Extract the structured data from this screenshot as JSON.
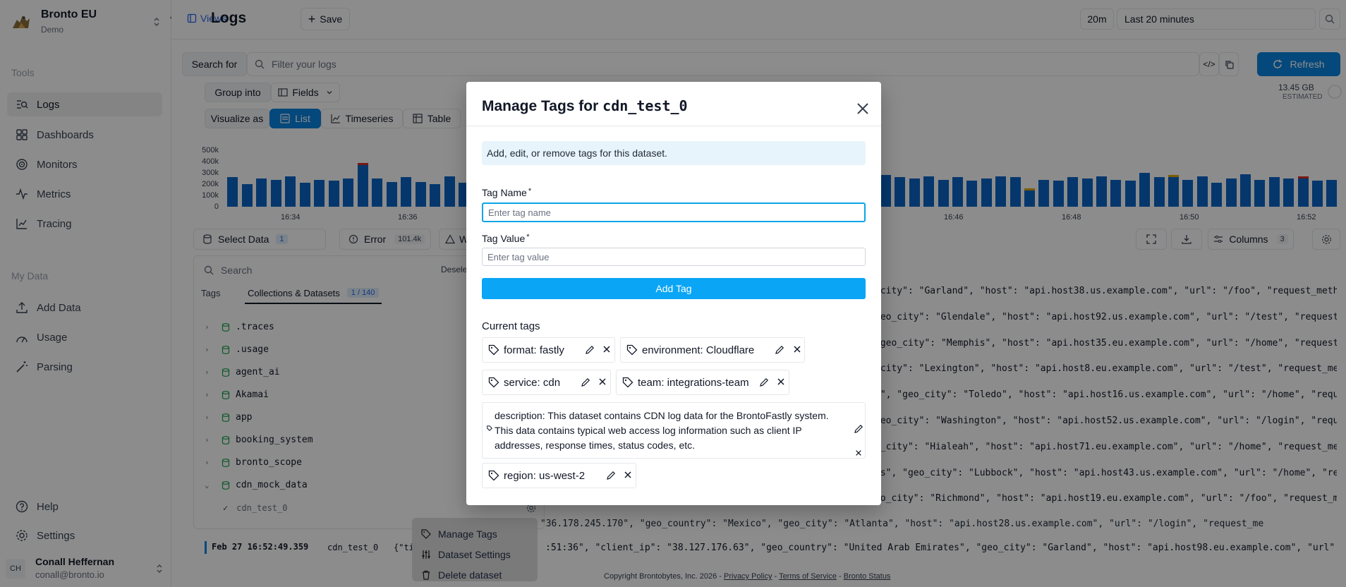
{
  "sidebar": {
    "org_name": "Bronto EU",
    "org_sub": "Demo",
    "tools_label": "Tools",
    "tools": [
      {
        "label": "Logs",
        "active": true
      },
      {
        "label": "Dashboards"
      },
      {
        "label": "Monitors"
      },
      {
        "label": "Metrics"
      },
      {
        "label": "Tracing"
      }
    ],
    "mydata_label": "My Data",
    "mydata": [
      {
        "label": "Add Data"
      },
      {
        "label": "Usage"
      },
      {
        "label": "Parsing"
      }
    ],
    "help": "Help",
    "settings": "Settings",
    "user_initials": "CH",
    "user_name": "Conall Heffernan",
    "user_email": "conall@bronto.io"
  },
  "topbar": {
    "views": "Views",
    "title": "Logs",
    "save": "Save",
    "time_short": "20m",
    "time_long": "Last 20 minutes"
  },
  "search": {
    "label": "Search for",
    "placeholder": "Filter your logs",
    "refresh": "Refresh",
    "size": "13.45 GB",
    "estimated": "ESTIMATED"
  },
  "controls": {
    "group_into": "Group into",
    "fields": "Fields",
    "visualize_as": "Visualize as",
    "list": "List",
    "timeseries": "Timeseries",
    "table": "Table"
  },
  "histogram": {
    "y_ticks": [
      "500k",
      "400k",
      "300k",
      "200k",
      "100k",
      "0"
    ],
    "x_ticks_left": [
      "16:34",
      "16:36"
    ],
    "x_ticks_right": [
      "16:46",
      "16:48",
      "16:50",
      "16:52"
    ],
    "values_left": [
      260,
      200,
      250,
      240,
      270,
      210,
      240,
      230,
      250,
      390,
      250,
      220,
      260,
      220,
      200,
      270,
      210,
      220,
      150,
      170
    ],
    "values_right": [
      280,
      260,
      250,
      270,
      240,
      260,
      230,
      250,
      270,
      260,
      160,
      240,
      230,
      260,
      250,
      270,
      240,
      230,
      300,
      260,
      280,
      240,
      270,
      210,
      250,
      290,
      240,
      260,
      250,
      270,
      230,
      240
    ],
    "red_left": [
      9
    ],
    "red_right": [
      29
    ],
    "yellow_right": [
      10,
      20
    ]
  },
  "filters": {
    "select_data": "Select Data",
    "select_count": "1",
    "error": "Error",
    "error_count": "101.4k",
    "warn_prefix": "W",
    "columns": "Columns",
    "columns_count": "3"
  },
  "datasets": {
    "search_placeholder": "Search",
    "deselect": "Deselec",
    "tab_tags": "Tags",
    "tab_collections": "Collections & Datasets",
    "tab_count": "1 / 140",
    "items": [
      ".traces",
      ".usage",
      "agent_ai",
      "Akamai",
      "app",
      "booking_system",
      "bronto_scope",
      "cdn_mock_data"
    ],
    "child": "cdn_test_0"
  },
  "logs": {
    "lines": [
      "_city\": \"Garland\", \"host\": \"api.host38.us.example.com\", \"url\": \"/foo\", \"request_method\"",
      "geo_city\": \"Glendale\", \"host\": \"api.host92.us.example.com\", \"url\": \"/test\", \"request_me",
      "\"geo_city\": \"Memphis\", \"host\": \"api.host35.eu.example.com\", \"url\": \"/home\", \"request_m",
      "_city\": \"Lexington\", \"host\": \"api.host8.eu.example.com\", \"url\": \"/test\", \"request_metho",
      "s\", \"geo_city\": \"Toledo\", \"host\": \"api.host16.us.example.com\", \"url\": \"/home\", \"request_",
      "geo_city\": \"Washington\", \"host\": \"api.host52.us.example.com\", \"url\": \"/login\", \"request",
      "o_city\": \"Hialeah\", \"host\": \"api.host71.eu.example.com\", \"url\": \"/home\", \"request_metho",
      "es\", \"geo_city\": \"Lubbock\", \"host\": \"api.host43.us.example.com\", \"url\": \"/home\", \"reque",
      "eo_city\": \"Richmond\", \"host\": \"api.host19.eu.example.com\", \"url\": \"/foo\", \"request_meth"
    ],
    "line_under_menu": "36\", \"client_ip\": \"36.178.245.170\", \"geo_country\": \"Mexico\", \"geo_city\": \"Atlanta\", \"host\": \"api.host28.us.example.com\", \"url\": \"/login\", \"request_me",
    "bottom_timestamp": "Feb 27 16:52:49.359",
    "bottom_dataset": "cdn_test_0",
    "bottom_prefix": "{\"ti",
    "bottom_rest": ":51:36\", \"client_ip\": \"38.127.176.63\", \"geo_country\": \"United Arab Emirates\", \"geo_city\": \"Garland\", \"host\": \"api.host98.eu.example.com\", \"url\": \"/test\","
  },
  "context_menu": {
    "items": [
      "Manage Tags",
      "Dataset Settings",
      "Delete dataset"
    ]
  },
  "footer": {
    "copyright": "Copyright Brontobytes, Inc. 2026 -",
    "privacy": "Privacy Policy",
    "terms": "Terms of Service",
    "status": "Bronto Status",
    "sep": "-"
  },
  "modal": {
    "title_prefix": "Manage Tags for",
    "title_dataset": "cdn_test_0",
    "info": "Add, edit, or remove tags for this dataset.",
    "tag_name_label": "Tag Name",
    "tag_name_placeholder": "Enter tag name",
    "tag_value_label": "Tag Value",
    "tag_value_placeholder": "Enter tag value",
    "required_mark": "*",
    "add_button": "Add Tag",
    "current_tags_label": "Current tags",
    "tags": [
      "format: fastly",
      "environment: Cloudflare",
      "service: cdn",
      "team: integrations-team",
      "region: us-west-2"
    ],
    "description_tag": "description: This dataset contains CDN log data for the BrontoFastly system. This data contains typical web access log information such as client IP addresses, response times, status codes, etc."
  }
}
